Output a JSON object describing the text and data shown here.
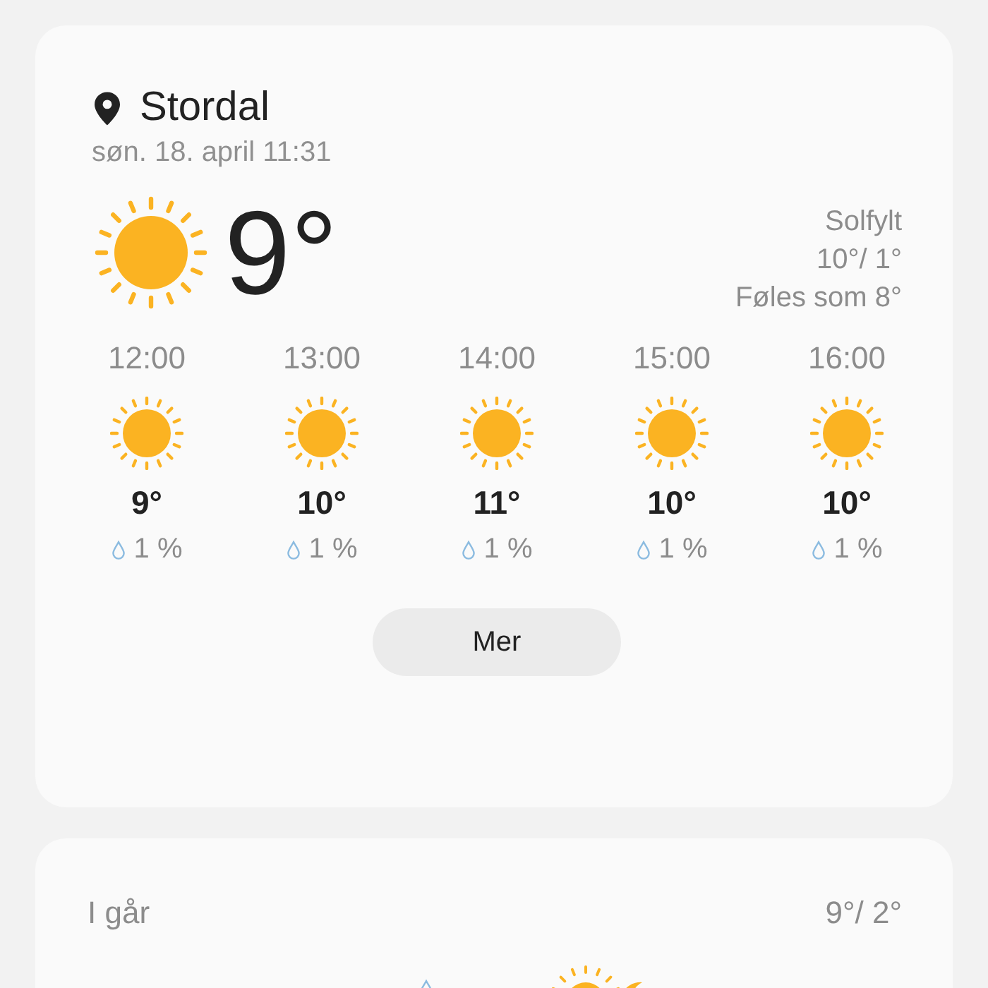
{
  "location": {
    "name": "Stordal",
    "datetime": "søn. 18. april 11:31"
  },
  "current": {
    "temp": "9°",
    "condition": "Solfylt",
    "high_low": "10°/ 1°",
    "feels_like": "Føles som 8°"
  },
  "hourly": [
    {
      "time": "12:00",
      "temp": "9°",
      "precip": "1 %"
    },
    {
      "time": "13:00",
      "temp": "10°",
      "precip": "1 %"
    },
    {
      "time": "14:00",
      "temp": "11°",
      "precip": "1 %"
    },
    {
      "time": "15:00",
      "temp": "10°",
      "precip": "1 %"
    },
    {
      "time": "16:00",
      "temp": "10°",
      "precip": "1 %"
    }
  ],
  "more_button": "Mer",
  "daily": {
    "yesterday_label": "I går",
    "yesterday_temps": "9°/ 2°"
  }
}
